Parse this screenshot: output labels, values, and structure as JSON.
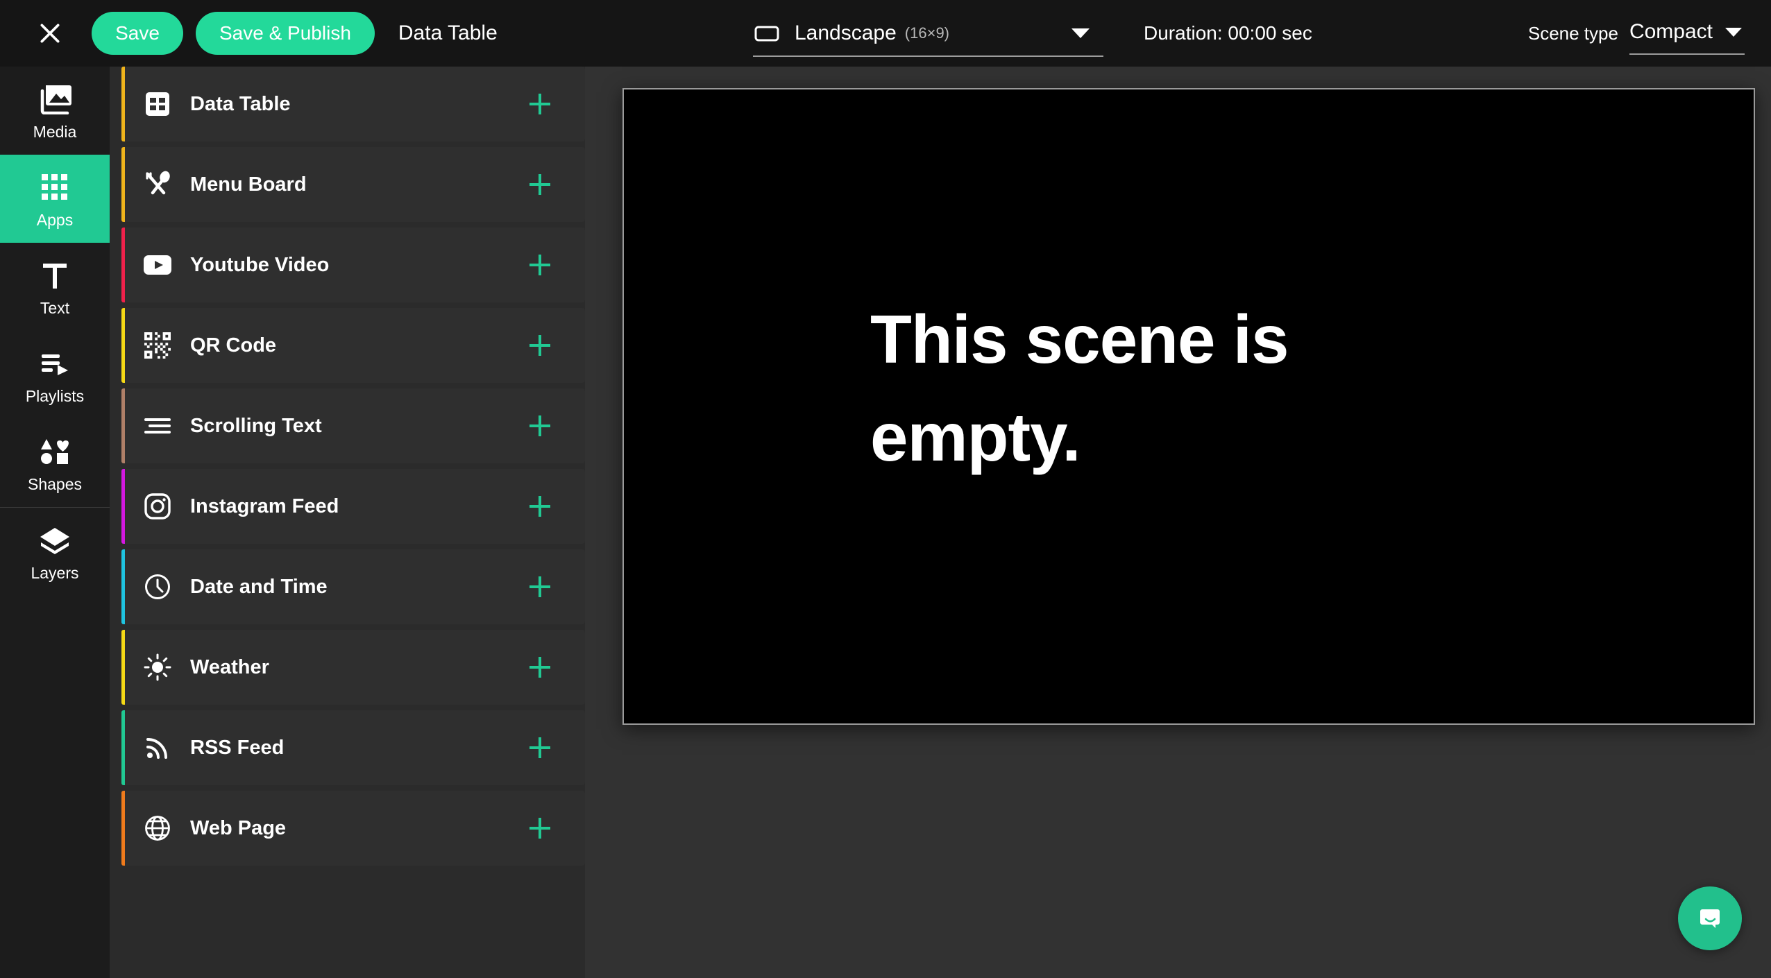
{
  "topbar": {
    "close_icon": "close-icon",
    "save_label": "Save",
    "save_publish_label": "Save & Publish",
    "scene_name": "Data Table",
    "orientation": {
      "icon": "landscape-rectangle-icon",
      "label": "Landscape",
      "ratio": "(16×9)",
      "caret": "chevron-down-icon"
    },
    "duration_label": "Duration: 00:00 sec",
    "scene_type_label": "Scene type",
    "scene_type_value": "Compact"
  },
  "sidebar": {
    "items": [
      {
        "label": "Media",
        "icon": "media-library-icon",
        "active": false
      },
      {
        "label": "Apps",
        "icon": "apps-grid-icon",
        "active": true
      },
      {
        "label": "Text",
        "icon": "text-t-icon",
        "active": false
      },
      {
        "label": "Playlists",
        "icon": "playlist-icon",
        "active": false
      },
      {
        "label": "Shapes",
        "icon": "shapes-icon",
        "active": false
      },
      {
        "label": "Layers",
        "icon": "layers-icon",
        "active": false
      }
    ]
  },
  "applist": {
    "add_icon": "plus-icon",
    "items": [
      {
        "label": "Data Table",
        "icon": "table-grid-icon",
        "accent": "#f0b41c"
      },
      {
        "label": "Menu Board",
        "icon": "cutlery-icon",
        "accent": "#f0b41c"
      },
      {
        "label": "Youtube Video",
        "icon": "youtube-icon",
        "accent": "#f0214b"
      },
      {
        "label": "QR Code",
        "icon": "qr-code-icon",
        "accent": "#f5d916"
      },
      {
        "label": "Scrolling Text",
        "icon": "text-lines-icon",
        "accent": "#b08068"
      },
      {
        "label": "Instagram Feed",
        "icon": "instagram-icon",
        "accent": "#d418e0"
      },
      {
        "label": "Date and Time",
        "icon": "clock-icon",
        "accent": "#1fc4e0"
      },
      {
        "label": "Weather",
        "icon": "sun-icon",
        "accent": "#f5d916"
      },
      {
        "label": "RSS Feed",
        "icon": "rss-icon",
        "accent": "#21c993"
      },
      {
        "label": "Web Page",
        "icon": "globe-icon",
        "accent": "#f07b1c"
      }
    ]
  },
  "canvas": {
    "empty_message": "This scene is empty."
  },
  "intercom": {
    "icon": "chat-bubble-smile-icon"
  },
  "colors": {
    "accent_green": "#23d99a",
    "rail_active": "#21c993",
    "topbar_bg": "#151515",
    "rail_bg": "#1c1c1c",
    "panel_bg": "#2b2b2b",
    "row_bg": "#2f2f2f",
    "stage_bg": "#323232",
    "canvas_bg": "#000000"
  }
}
